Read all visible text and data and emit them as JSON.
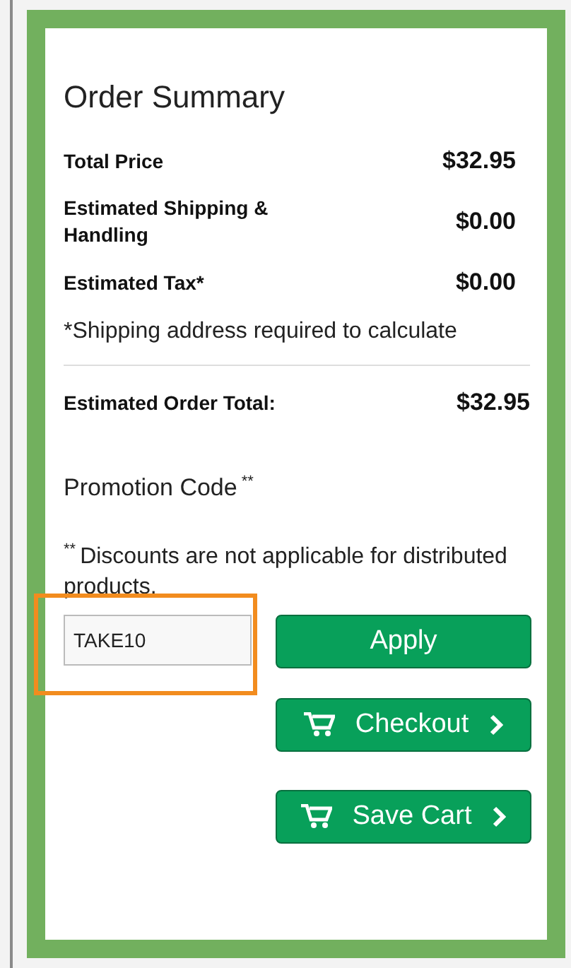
{
  "title": "Order Summary",
  "lines": [
    {
      "label": "Total Price",
      "value": "$32.95"
    },
    {
      "label": "Estimated Shipping & Handling",
      "value": "$0.00"
    },
    {
      "label": "Estimated Tax*",
      "value": "$0.00"
    }
  ],
  "footnote": "*Shipping address required to calculate",
  "total": {
    "label": "Estimated Order Total:",
    "value": "$32.95"
  },
  "promotion": {
    "label": "Promotion Code",
    "mark": "**",
    "note_mark": "**",
    "note": "Discounts are not applicable for distributed products.",
    "value": "TAKE10",
    "highlighted": true
  },
  "buttons": [
    {
      "kind": "plain",
      "label": "Apply"
    },
    {
      "kind": "cart",
      "label": "Checkout"
    },
    {
      "kind": "cart",
      "label": "Save Cart"
    }
  ]
}
